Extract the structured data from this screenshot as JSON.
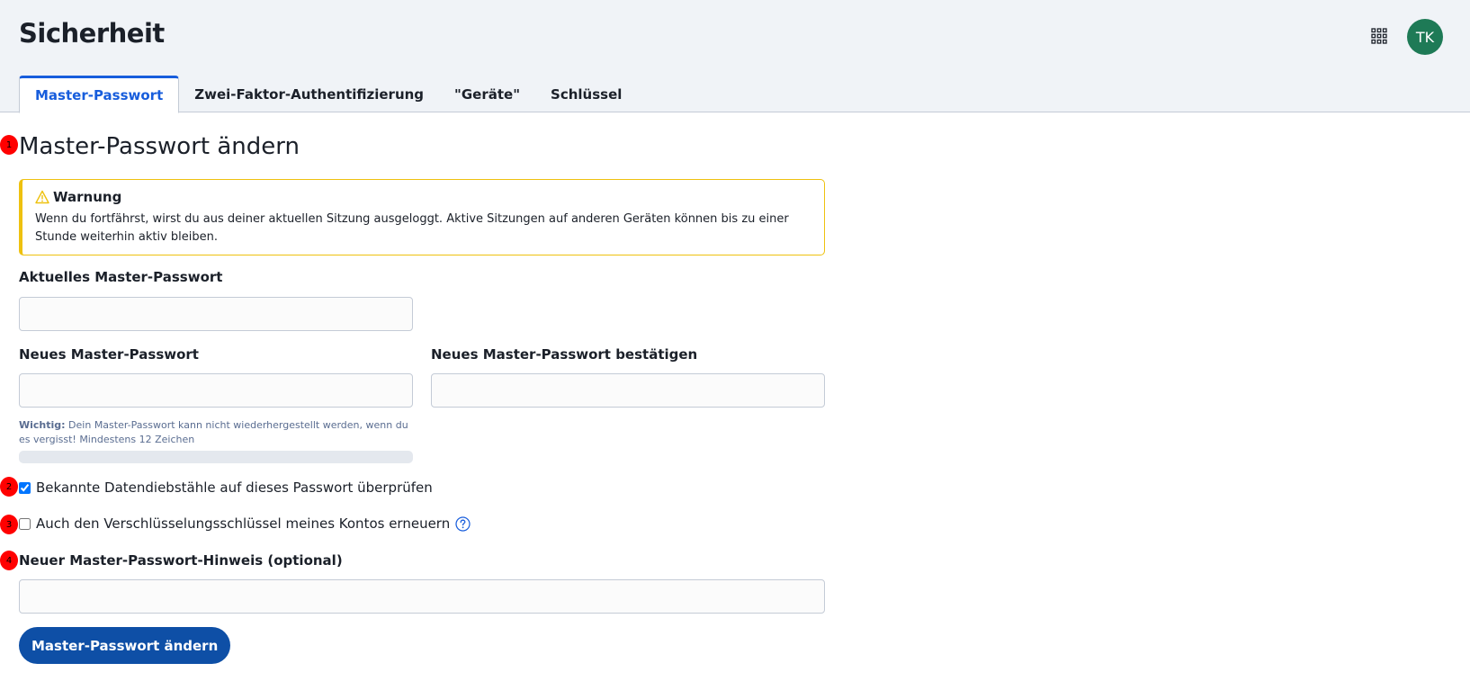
{
  "header": {
    "title": "Sicherheit",
    "avatar_initials": "TK",
    "apps_icon": "grid-apps-icon"
  },
  "tabs": [
    {
      "label": "Master-Passwort",
      "active": true
    },
    {
      "label": "Zwei-Faktor-Authentifizierung",
      "active": false
    },
    {
      "label": "\"Geräte\"",
      "active": false
    },
    {
      "label": "Schlüssel",
      "active": false
    }
  ],
  "markers": [
    "1",
    "2",
    "3",
    "4"
  ],
  "section": {
    "title": "Master-Passwort ändern"
  },
  "warning": {
    "title": "Warnung",
    "text": "Wenn du fortfährst, wirst du aus deiner aktuellen Sitzung ausgeloggt. Aktive Sitzungen auf anderen Geräten können bis zu einer Stunde weiterhin aktiv bleiben."
  },
  "form": {
    "current_label": "Aktuelles Master-Passwort",
    "current_value": "",
    "new_label": "Neues Master-Passwort",
    "new_value": "",
    "confirm_label": "Neues Master-Passwort bestätigen",
    "confirm_value": "",
    "hint_strong": "Wichtig:",
    "hint_text": " Dein Master-Passwort kann nicht wiederhergestellt werden, wenn du es vergisst! Mindestens 12 Zeichen",
    "check_breach_label": "Bekannte Datendiebstähle auf dieses Passwort überprüfen",
    "check_breach_checked": true,
    "check_rotate_label": "Auch den Verschlüsselungsschlüssel meines Kontos erneuern",
    "check_rotate_checked": false,
    "hint_field_label": "Neuer Master-Passwort-Hinweis (optional)",
    "hint_field_value": "",
    "submit_label": "Master-Passwort ändern"
  },
  "colors": {
    "accent": "#175ddc",
    "button": "#0e4fa6",
    "warning_border": "#eec10f",
    "avatar": "#1e7a56",
    "marker": "#ff0000"
  }
}
